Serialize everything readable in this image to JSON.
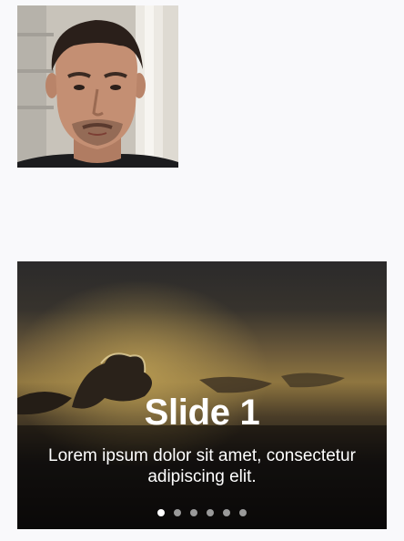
{
  "avatar": {
    "icon": "profile-photo"
  },
  "carousel": {
    "active_index": 0,
    "slides": [
      {
        "title": "Slide 1",
        "text": "Lorem ipsum dolor sit amet, consectetur adipiscing elit."
      }
    ],
    "dot_count": 6,
    "colors": {
      "dot_active": "#ffffff",
      "dot_inactive": "#9a9a9a"
    }
  }
}
